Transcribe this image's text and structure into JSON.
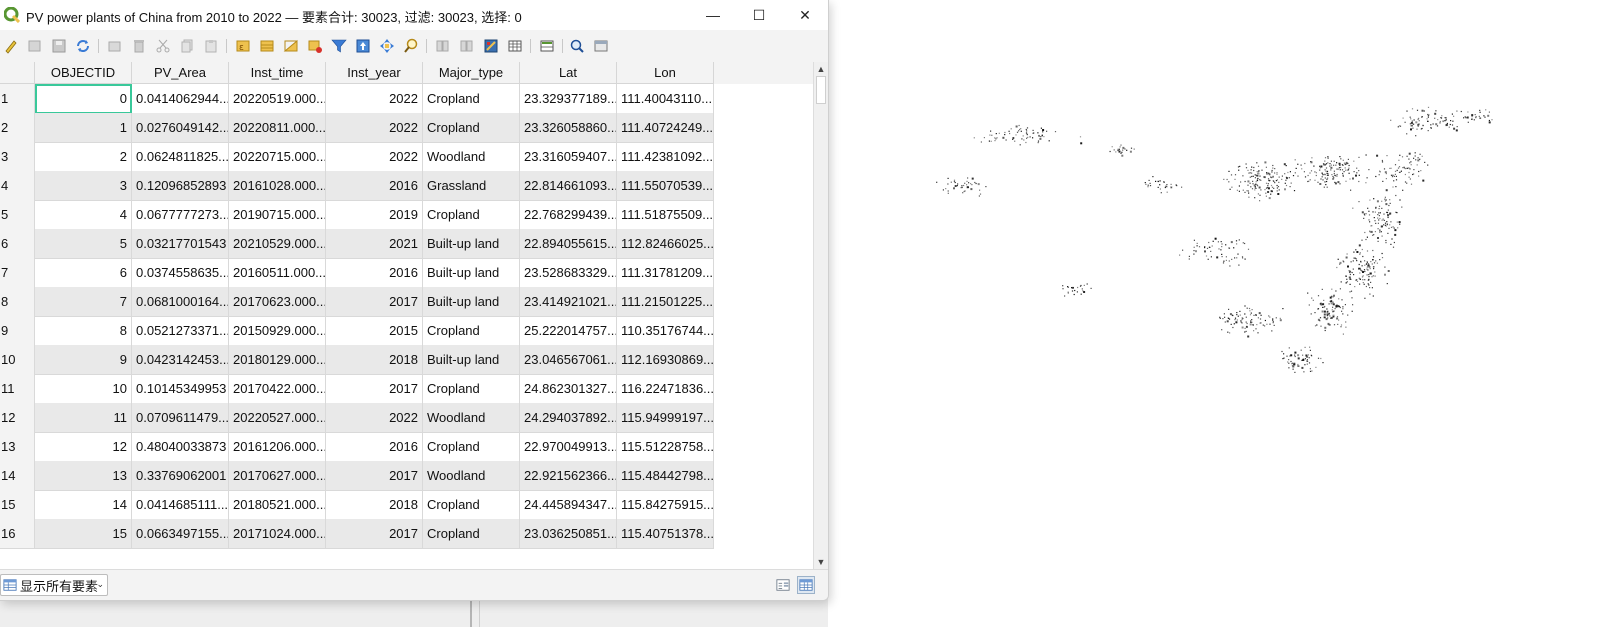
{
  "window": {
    "title": "PV power plants of China from 2010 to 2022 — 要素合计: 30023, 过滤: 30023, 选择: 0",
    "minimize_glyph": "—",
    "maximize_glyph": "☐",
    "close_glyph": "✕"
  },
  "toolbar": {
    "icons": [
      "toggle-editing-icon",
      "multi-edit-icon",
      "save-edits-icon",
      "reload-icon",
      "add-feature-icon",
      "delete-selected-icon",
      "cut-icon",
      "copy-icon",
      "paste-icon",
      "select-by-expression-icon",
      "select-all-icon",
      "invert-selection-icon",
      "deselect-all-icon",
      "filter-select-icon",
      "move-selection-top-icon",
      "pan-to-selected-icon",
      "zoom-to-selected-icon",
      "new-field-icon",
      "delete-field-icon",
      "field-calculator-icon",
      "conditional-formatting-icon",
      "actions-icon",
      "dock-table-icon",
      "organize-columns-icon"
    ]
  },
  "table": {
    "columns": [
      "OBJECTID",
      "PV_Area",
      "Inst_time",
      "Inst_year",
      "Major_type",
      "Lat",
      "Lon"
    ],
    "rows": [
      {
        "n": "1",
        "objectid": "0",
        "pv_area": "0.0414062944...",
        "inst_time": "20220519.000...",
        "inst_year": "2022",
        "major_type": "Cropland",
        "lat": "23.329377189...",
        "lon": "111.40043110..."
      },
      {
        "n": "2",
        "objectid": "1",
        "pv_area": "0.0276049142...",
        "inst_time": "20220811.000...",
        "inst_year": "2022",
        "major_type": "Cropland",
        "lat": "23.326058860...",
        "lon": "111.40724249..."
      },
      {
        "n": "3",
        "objectid": "2",
        "pv_area": "0.0624811825...",
        "inst_time": "20220715.000...",
        "inst_year": "2022",
        "major_type": "Woodland",
        "lat": "23.316059407...",
        "lon": "111.42381092..."
      },
      {
        "n": "4",
        "objectid": "3",
        "pv_area": "0.12096852893",
        "inst_time": "20161028.000...",
        "inst_year": "2016",
        "major_type": "Grassland",
        "lat": "22.814661093...",
        "lon": "111.55070539..."
      },
      {
        "n": "5",
        "objectid": "4",
        "pv_area": "0.0677777273...",
        "inst_time": "20190715.000...",
        "inst_year": "2019",
        "major_type": "Cropland",
        "lat": "22.768299439...",
        "lon": "111.51875509..."
      },
      {
        "n": "6",
        "objectid": "5",
        "pv_area": "0.03217701543",
        "inst_time": "20210529.000...",
        "inst_year": "2021",
        "major_type": "Built-up land",
        "lat": "22.894055615...",
        "lon": "112.82466025..."
      },
      {
        "n": "7",
        "objectid": "6",
        "pv_area": "0.0374558635...",
        "inst_time": "20160511.000...",
        "inst_year": "2016",
        "major_type": "Built-up land",
        "lat": "23.528683329...",
        "lon": "111.31781209..."
      },
      {
        "n": "8",
        "objectid": "7",
        "pv_area": "0.0681000164...",
        "inst_time": "20170623.000...",
        "inst_year": "2017",
        "major_type": "Built-up land",
        "lat": "23.414921021...",
        "lon": "111.21501225..."
      },
      {
        "n": "9",
        "objectid": "8",
        "pv_area": "0.0521273371...",
        "inst_time": "20150929.000...",
        "inst_year": "2015",
        "major_type": "Cropland",
        "lat": "25.222014757...",
        "lon": "110.35176744..."
      },
      {
        "n": "10",
        "objectid": "9",
        "pv_area": "0.0423142453...",
        "inst_time": "20180129.000...",
        "inst_year": "2018",
        "major_type": "Built-up land",
        "lat": "23.046567061...",
        "lon": "112.16930869..."
      },
      {
        "n": "11",
        "objectid": "10",
        "pv_area": "0.10145349953",
        "inst_time": "20170422.000...",
        "inst_year": "2017",
        "major_type": "Cropland",
        "lat": "24.862301327...",
        "lon": "116.22471836..."
      },
      {
        "n": "12",
        "objectid": "11",
        "pv_area": "0.0709611479...",
        "inst_time": "20220527.000...",
        "inst_year": "2022",
        "major_type": "Woodland",
        "lat": "24.294037892...",
        "lon": "115.94999197..."
      },
      {
        "n": "13",
        "objectid": "12",
        "pv_area": "0.48040033873",
        "inst_time": "20161206.000...",
        "inst_year": "2016",
        "major_type": "Cropland",
        "lat": "22.970049913...",
        "lon": "115.51228758..."
      },
      {
        "n": "14",
        "objectid": "13",
        "pv_area": "0.33769062001",
        "inst_time": "20170627.000...",
        "inst_year": "2017",
        "major_type": "Woodland",
        "lat": "22.921562366...",
        "lon": "115.48442798..."
      },
      {
        "n": "15",
        "objectid": "14",
        "pv_area": "0.0414685111...",
        "inst_time": "20180521.000...",
        "inst_year": "2018",
        "major_type": "Cropland",
        "lat": "24.445894347...",
        "lon": "115.84275915..."
      },
      {
        "n": "16",
        "objectid": "15",
        "pv_area": "0.0663497155...",
        "inst_time": "20171024.000...",
        "inst_year": "2017",
        "major_type": "Cropland",
        "lat": "23.036250851...",
        "lon": "115.40751378..."
      }
    ]
  },
  "statusbar": {
    "filter_label": "显示所有要素",
    "caret": "⌄"
  },
  "colors": {
    "accent_selection": "#39c89a",
    "qgis_green": "#589632",
    "qgis_yellow": "#eec14e",
    "refresh_blue": "#3a7bd5",
    "map_points": "#111111"
  }
}
